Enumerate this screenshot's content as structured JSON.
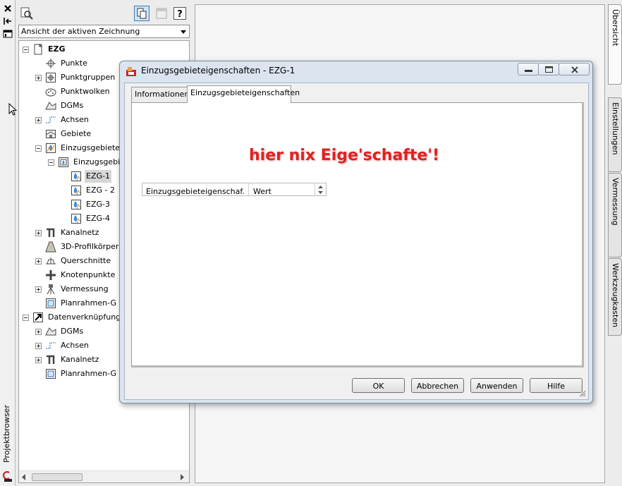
{
  "strip": {
    "title": "Projektbrowser",
    "buttons": [
      "close-icon",
      "autohide-icon",
      "properties-icon"
    ]
  },
  "browser": {
    "toolbar": [
      "search-icon",
      "item-view-icon",
      "list-view-icon",
      "help-icon"
    ],
    "view_select": "Ansicht der aktiven Zeichnung",
    "tree": [
      {
        "label": "EZG",
        "icon": "drawing-icon",
        "bold": true,
        "expander": "minus"
      },
      {
        "label": "Punkte",
        "icon": "point-icon",
        "expander": ""
      },
      {
        "label": "Punktgruppen",
        "icon": "point-group-icon",
        "expander": "plus"
      },
      {
        "label": "Punktwolken",
        "icon": "point-cloud-icon",
        "expander": ""
      },
      {
        "label": "DGMs",
        "icon": "surface-icon",
        "expander": ""
      },
      {
        "label": "Achsen",
        "icon": "alignment-icon",
        "expander": "plus"
      },
      {
        "label": "Gebiete",
        "icon": "site-icon",
        "expander": ""
      },
      {
        "label": "Einzugsgebiete",
        "icon": "catchment-icon",
        "expander": "minus"
      },
      {
        "label": "Einzugsgebiet",
        "icon": "catchment-group-icon",
        "expander": "minus"
      },
      {
        "label": "EZG-1",
        "icon": "catchment-item-icon",
        "expander": "",
        "selected": true
      },
      {
        "label": "EZG - 2",
        "icon": "catchment-item-icon",
        "expander": ""
      },
      {
        "label": "EZG-3",
        "icon": "catchment-item-icon",
        "expander": ""
      },
      {
        "label": "EZG-4",
        "icon": "catchment-item-icon",
        "expander": ""
      },
      {
        "label": "Kanalnetz",
        "icon": "pipe-network-icon",
        "expander": "plus"
      },
      {
        "label": "3D-Profilkörper",
        "icon": "corridor-icon",
        "expander": ""
      },
      {
        "label": "Querschnitte",
        "icon": "assembly-icon",
        "expander": "plus"
      },
      {
        "label": "Knotenpunkte",
        "icon": "intersection-icon",
        "expander": ""
      },
      {
        "label": "Vermessung",
        "icon": "survey-icon",
        "expander": "plus"
      },
      {
        "label": "Planrahmen-G",
        "icon": "view-frame-icon",
        "expander": ""
      },
      {
        "label": "Datenverknüpfung",
        "icon": "data-shortcut-icon",
        "expander": "minus"
      },
      {
        "label": "DGMs",
        "icon": "surface-icon",
        "expander": "plus"
      },
      {
        "label": "Achsen",
        "icon": "alignment-icon",
        "expander": "plus"
      },
      {
        "label": "Kanalnetz",
        "icon": "pipe-network-icon",
        "expander": "plus"
      },
      {
        "label": "Planrahmen-G",
        "icon": "view-frame-icon",
        "expander": ""
      }
    ]
  },
  "right_tabs": [
    {
      "label": "Übersicht",
      "active": true
    },
    {
      "label": "Einstellungen",
      "active": false
    },
    {
      "label": "Vermessung",
      "active": false
    },
    {
      "label": "Werkzeugkasten",
      "active": false
    }
  ],
  "dialog": {
    "title": "Einzugsgebieteigenschaften - EZG-1",
    "window_buttons": [
      "minimize-icon",
      "maximize-icon",
      "close-icon"
    ],
    "tabs": [
      {
        "label": "Informationen",
        "active": false
      },
      {
        "label": "Einzugsgebieteigenschaften",
        "active": true
      }
    ],
    "annotation": "hier nix Eige'schafte'!",
    "grid": {
      "col1": "Einzugsgebieteigenschaf...",
      "col2": "Wert"
    },
    "buttons": {
      "ok": "OK",
      "cancel": "Abbrechen",
      "apply": "Anwenden",
      "help": "Hilfe"
    }
  }
}
